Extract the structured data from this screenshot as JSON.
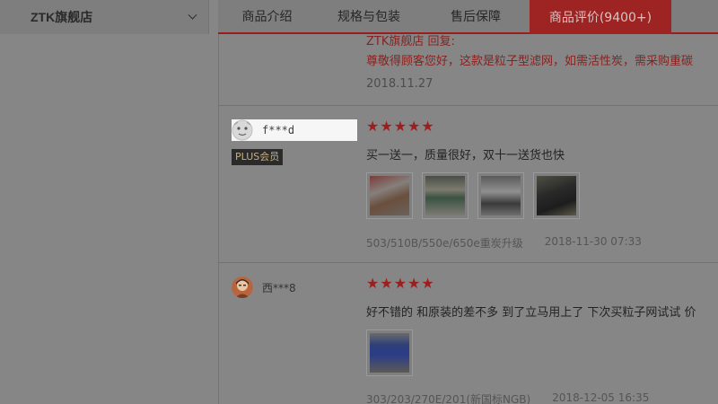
{
  "shop": {
    "name": "ZTK旗舰店"
  },
  "tabs": [
    {
      "label": "商品介绍"
    },
    {
      "label": "规格与包装"
    },
    {
      "label": "售后保障"
    },
    {
      "label": "商品评价(9400+)"
    }
  ],
  "reply": {
    "title": "ZTK旗舰店 回复:",
    "text": "尊敬得顾客您好，这款是粒子型滤网，如需活性炭，需采购重碳",
    "date": "2018.11.27"
  },
  "reviews": [
    {
      "user": "f***d",
      "badge": "PLUS会员",
      "stars": 5,
      "text": "买一送一，质量很好，双十一送货也快",
      "variant": "503/510B/550e/650e重炭升级",
      "date": "2018-11-30 07:33"
    },
    {
      "user": "西***8",
      "stars": 5,
      "text": "好不错的 和原装的差不多 到了立马用上了 下次买粒子网试试 价",
      "variant": "303/203/270E/201(新国标NGB)",
      "date": "2018-12-05 16:35"
    }
  ],
  "icons": {
    "star": "★"
  },
  "colors": {
    "accent": "#9e2424",
    "reply": "#872320"
  }
}
